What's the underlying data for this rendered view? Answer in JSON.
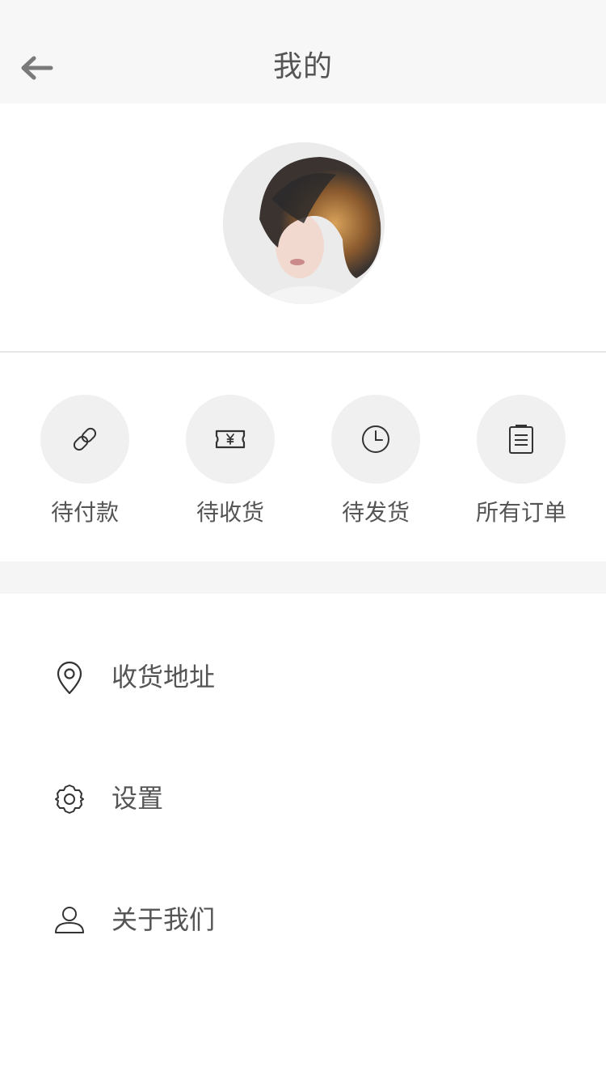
{
  "header": {
    "title": "我的",
    "back_icon": "arrow-left-icon"
  },
  "profile": {
    "avatar_icon": "avatar"
  },
  "orders": [
    {
      "label": "待付款",
      "icon": "link-icon"
    },
    {
      "label": "待收货",
      "icon": "ticket-yen-icon"
    },
    {
      "label": "待发货",
      "icon": "clock-icon"
    },
    {
      "label": "所有订单",
      "icon": "list-icon"
    }
  ],
  "menu": [
    {
      "label": "收货地址",
      "icon": "location-pin-icon"
    },
    {
      "label": "设置",
      "icon": "gear-icon"
    },
    {
      "label": "关于我们",
      "icon": "user-icon"
    }
  ],
  "colors": {
    "header_bg": "#f7f7f7",
    "text": "#555555",
    "icon_circle_bg": "#f0f0f0",
    "section_gap": "#f5f5f5"
  }
}
